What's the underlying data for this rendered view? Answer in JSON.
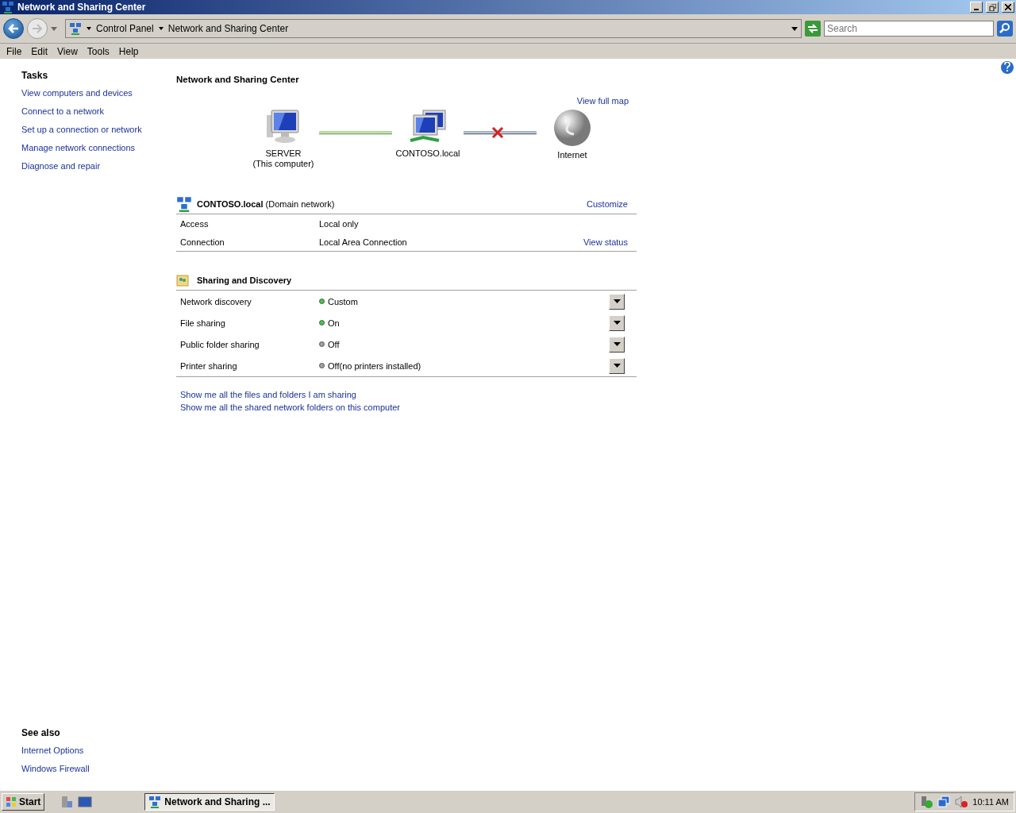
{
  "window": {
    "title": "Network and Sharing Center"
  },
  "address": {
    "crumbs": [
      "Control Panel",
      "Network and Sharing Center"
    ],
    "search_placeholder": "Search"
  },
  "menu": [
    "File",
    "Edit",
    "View",
    "Tools",
    "Help"
  ],
  "sidebar": {
    "tasks_title": "Tasks",
    "tasks": [
      "View computers and devices",
      "Connect to a network",
      "Set up a connection or network",
      "Manage network connections",
      "Diagnose and repair"
    ],
    "see_also_title": "See also",
    "see_also": [
      "Internet Options",
      "Windows Firewall"
    ]
  },
  "main": {
    "title": "Network and Sharing Center",
    "view_full_map": "View full map",
    "map": [
      {
        "kind": "computer",
        "label": "SERVER",
        "sublabel": "(This computer)"
      },
      {
        "kind": "link",
        "connected": true
      },
      {
        "kind": "network",
        "label": "CONTOSO.local"
      },
      {
        "kind": "link",
        "connected": false
      },
      {
        "kind": "internet",
        "label": "Internet"
      }
    ],
    "network": {
      "name": "CONTOSO.local",
      "type": "(Domain network)",
      "action": "Customize",
      "rows": [
        {
          "label": "Access",
          "value": "Local only"
        },
        {
          "label": "Connection",
          "value": "Local Area Connection",
          "action": "View status"
        }
      ]
    },
    "sharing": {
      "title": "Sharing and Discovery",
      "rows": [
        {
          "label": "Network discovery",
          "on": true,
          "value": "Custom"
        },
        {
          "label": "File sharing",
          "on": true,
          "value": "On"
        },
        {
          "label": "Public folder sharing",
          "on": false,
          "value": "Off"
        },
        {
          "label": "Printer sharing",
          "on": false,
          "value": "Off(no printers installed)"
        }
      ]
    },
    "links": [
      "Show me all the files and folders I am sharing",
      "Show me all the shared network folders on this computer"
    ]
  },
  "taskbar": {
    "start": "Start",
    "task": "Network and Sharing ...",
    "clock": "10:11 AM"
  }
}
